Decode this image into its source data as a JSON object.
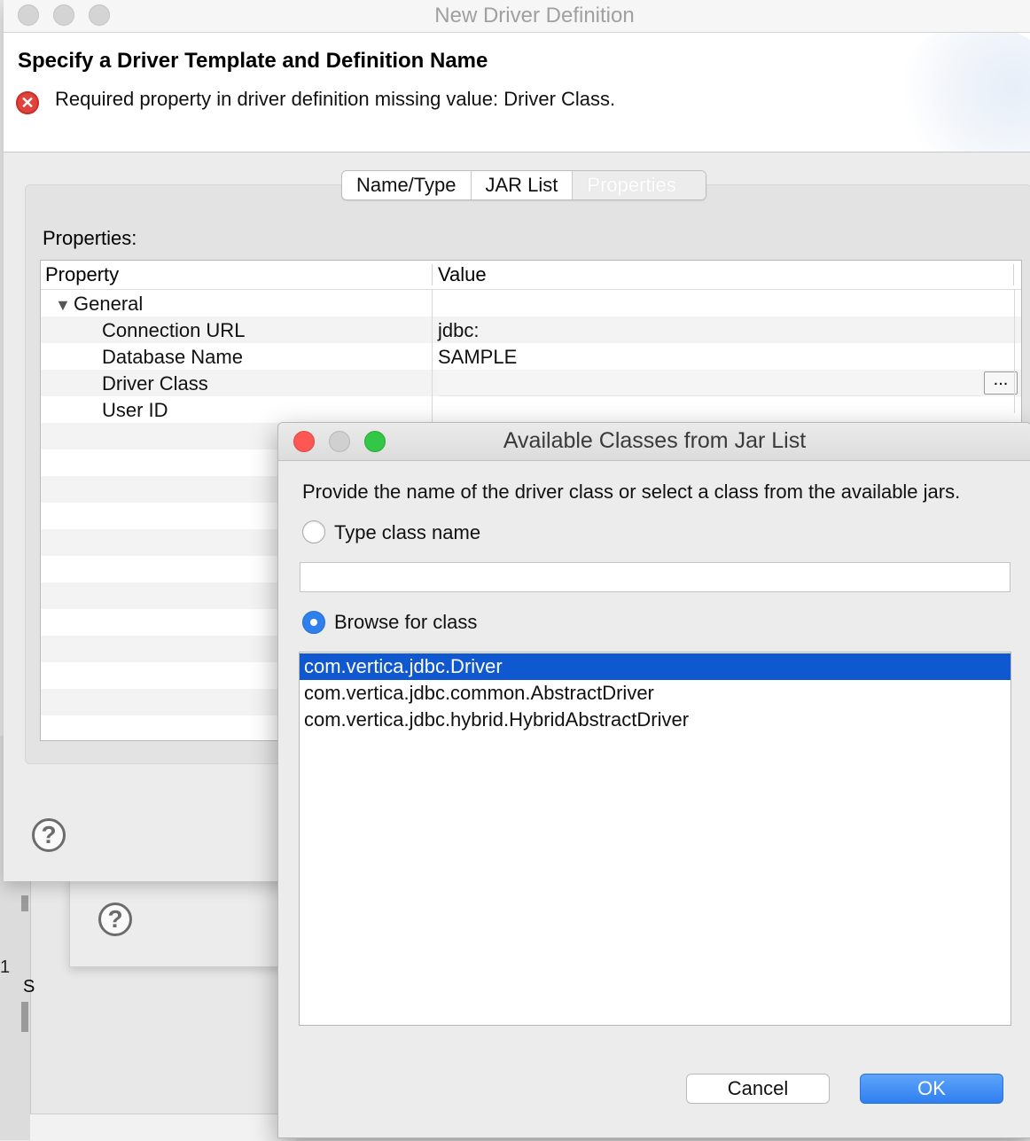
{
  "main_dialog": {
    "title": "New Driver Definition",
    "header_title": "Specify a Driver Template and Definition Name",
    "error_message": "Required property in driver definition missing value: Driver Class.",
    "tabs": [
      {
        "label": "Name/Type",
        "active": false
      },
      {
        "label": "JAR List",
        "active": false
      },
      {
        "label": "Properties",
        "active": true
      }
    ],
    "properties_label": "Properties:",
    "table": {
      "columns": [
        "Property",
        "Value"
      ],
      "group": "General",
      "rows": [
        {
          "property": "Connection URL",
          "value": "jdbc:"
        },
        {
          "property": "Database Name",
          "value": "SAMPLE"
        },
        {
          "property": "Driver Class",
          "value": ""
        },
        {
          "property": "User ID",
          "value": ""
        }
      ],
      "browse_button": "..."
    },
    "help_icon": "question-circle-icon"
  },
  "background": {
    "help_icon": "question-circle-icon",
    "fragment_1": "1",
    "fragment_s": "S"
  },
  "class_dialog": {
    "title": "Available Classes from Jar List",
    "instruction": "Provide the name of the driver class or select a class from the available jars.",
    "option_type": {
      "label": "Type class name",
      "selected": false
    },
    "type_input": {
      "value": "",
      "placeholder": ""
    },
    "option_browse": {
      "label": "Browse for class",
      "selected": true
    },
    "classes": [
      {
        "name": "com.vertica.jdbc.Driver",
        "selected": true
      },
      {
        "name": "com.vertica.jdbc.common.AbstractDriver",
        "selected": false
      },
      {
        "name": "com.vertica.jdbc.hybrid.HybridAbstractDriver",
        "selected": false
      }
    ],
    "cancel_label": "Cancel",
    "ok_label": "OK"
  },
  "colors": {
    "selection": "#1058d0",
    "ok_button": "#2f7ff0",
    "error_icon": "#e0433b",
    "close_button": "#fc5753",
    "zoom_button": "#33c748"
  }
}
